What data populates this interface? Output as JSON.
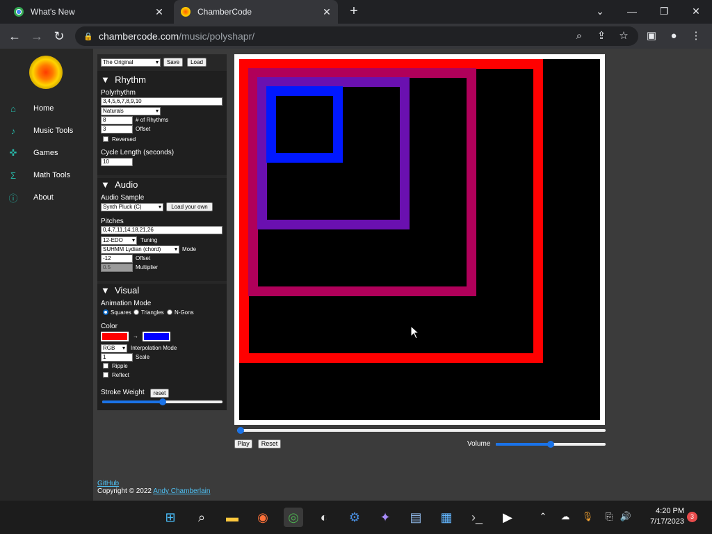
{
  "browser": {
    "tabs": [
      {
        "title": "What's New",
        "favicon": "chrome-icon"
      },
      {
        "title": "ChamberCode",
        "favicon": "chambercode-icon"
      }
    ],
    "url_host": "chambercode.com",
    "url_path": "/music/polyshapr/"
  },
  "sidebar": {
    "items": [
      {
        "label": "Home",
        "icon": "home-icon"
      },
      {
        "label": "Music Tools",
        "icon": "music-note-icon"
      },
      {
        "label": "Games",
        "icon": "gamepad-icon"
      },
      {
        "label": "Math Tools",
        "icon": "sigma-icon"
      },
      {
        "label": "About",
        "icon": "info-icon"
      }
    ]
  },
  "controls": {
    "preset": "The Original",
    "save_label": "Save",
    "load_label": "Load",
    "rhythm": {
      "header": "Rhythm",
      "polyrhythm_label": "Polyrhythm",
      "polyrhythm_value": "3,4,5,6,7,8,9,10",
      "preset_select": "Naturals",
      "num_rhythms": "8",
      "num_rhythms_label": "# of Rhythms",
      "offset": "3",
      "offset_label": "Offset",
      "reversed_label": "Reversed",
      "cycle_label": "Cycle Length (seconds)",
      "cycle_value": "10"
    },
    "audio": {
      "header": "Audio",
      "sample_label": "Audio Sample",
      "sample_value": "Synth Pluck (C)",
      "load_own_label": "Load your own",
      "pitches_label": "Pitches",
      "pitches_value": "0,4,7,11,14,18,21,26",
      "tuning_value": "12-EDO",
      "tuning_label": "Tuning",
      "mode_value": "SUHMM Lydian (chord)",
      "mode_label": "Mode",
      "offset_value": "-12",
      "offset_label": "Offset",
      "multiplier_value": "0.5",
      "multiplier_label": "Multiplier"
    },
    "visual": {
      "header": "Visual",
      "anim_label": "Animation Mode",
      "mode_squares": "Squares",
      "mode_triangles": "Triangles",
      "mode_ngons": "N-Gons",
      "color_label": "Color",
      "color_from": "#ff0000",
      "color_to": "#0000ff",
      "interp_value": "RGB",
      "interp_label": "Interpolation Mode",
      "scale_value": "1",
      "scale_label": "Scale",
      "ripple_label": "Ripple",
      "reflect_label": "Reflect",
      "stroke_label": "Stroke Weight",
      "stroke_reset": "reset",
      "stroke_level": 0.5
    }
  },
  "player": {
    "play_label": "Play",
    "reset_label": "Reset",
    "volume_label": "Volume",
    "volume_level": 0.5,
    "progress_level": 0.0
  },
  "footer": {
    "github": "GitHub",
    "copyright": "Copyright © 2022",
    "author": "Andy Chamberlain"
  },
  "taskbar": {
    "time": "4:20 PM",
    "date": "7/17/2023",
    "badge": "3"
  }
}
